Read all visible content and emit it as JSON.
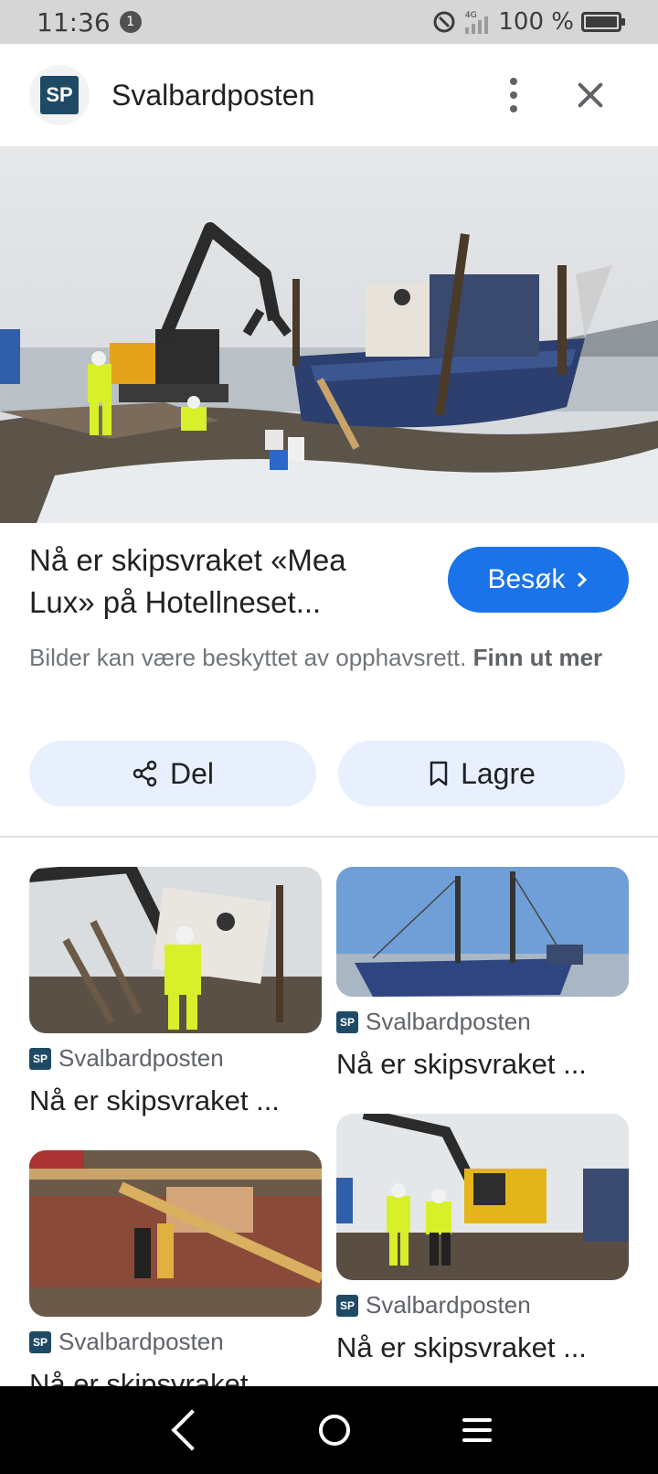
{
  "status_bar": {
    "time": "11:36",
    "notification_count": "1",
    "network": "4G",
    "battery": "100 %",
    "battery_level": 1.0
  },
  "header": {
    "logo_text": "SP",
    "site_name": "Svalbardposten",
    "icons": [
      "more-vert-icon",
      "close-icon"
    ]
  },
  "article": {
    "title": "Nå er skipsvraket «Mea Lux» på Hotellneset...",
    "visit_label": "Besøk",
    "copyright_text": "Bilder kan være beskyttet av opphavsrett.",
    "learn_more": "Finn ut mer"
  },
  "actions": {
    "share_label": "Del",
    "save_label": "Lagre"
  },
  "related": [
    {
      "source": "Svalbardposten",
      "title": "Nå er skipsvraket ..."
    },
    {
      "source": "Svalbardposten",
      "title": "Nå er skipsvraket ..."
    },
    {
      "source": "Svalbardposten",
      "title": "Nå er skipsvraket"
    },
    {
      "source": "Svalbardposten",
      "title": "Nå er skipsvraket ..."
    }
  ],
  "colors": {
    "accent": "#1a73e8",
    "chip_bg": "#e8f0fe",
    "logo_bg": "#1f4a66"
  }
}
